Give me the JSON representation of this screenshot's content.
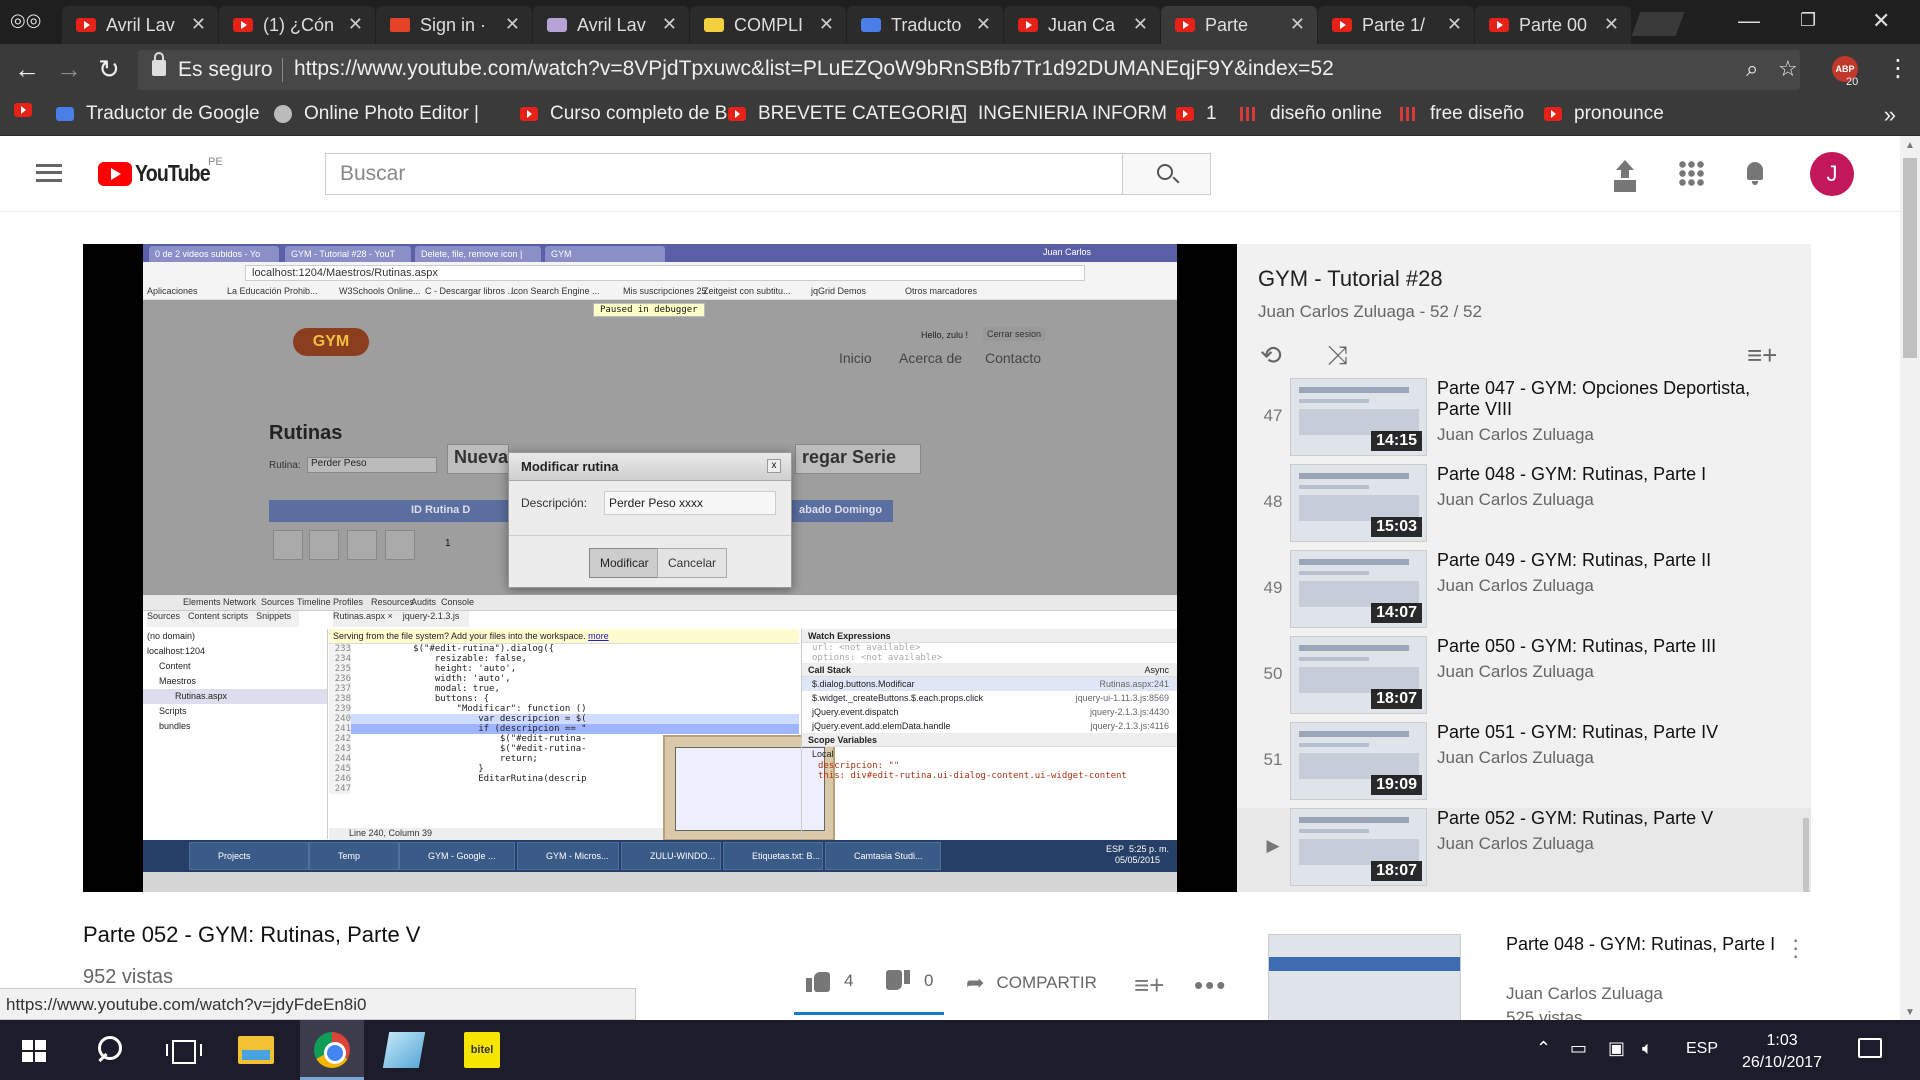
{
  "browser": {
    "tabs": [
      {
        "label": "Avril Lav",
        "icon": "youtube-icon"
      },
      {
        "label": "(1) ¿Cón",
        "icon": "youtube-icon"
      },
      {
        "label": "Sign in ·",
        "icon": "gitlab-icon"
      },
      {
        "label": "Avril Lav",
        "icon": "pattern-icon"
      },
      {
        "label": "COMPLI",
        "icon": "star-icon"
      },
      {
        "label": "Traducto",
        "icon": "google-translate-icon"
      },
      {
        "label": "Juan Ca",
        "icon": "youtube-icon"
      },
      {
        "label": "Parte",
        "icon": "youtube-icon"
      },
      {
        "label": "Parte 1/",
        "icon": "youtube-icon"
      },
      {
        "label": "Parte 00",
        "icon": "youtube-icon"
      }
    ],
    "active_tab_index": 7,
    "secure_label": "Es seguro",
    "url": "https://www.youtube.com/watch?v=8VPjdTpxuwc&list=PLuEZQoW9bRnSBfb7Tr1d92DUMANEqjF9Y&index=52",
    "extension_label": "ABP",
    "extension_badge": "20",
    "bookmarks": [
      {
        "label": "",
        "icon": "youtube-icon"
      },
      {
        "label": "Traductor de Google",
        "icon": "google-translate-icon"
      },
      {
        "label": "Online Photo Editor |",
        "icon": "photo-editor-icon"
      },
      {
        "label": "Curso completo de B",
        "icon": "youtube-icon"
      },
      {
        "label": "BREVETE CATEGORIA",
        "icon": "youtube-icon"
      },
      {
        "label": "INGENIERIA INFORM",
        "icon": "document-icon"
      },
      {
        "label": "1",
        "icon": "youtube-icon"
      },
      {
        "label": "diseño online",
        "icon": "bars-icon"
      },
      {
        "label": "free diseño",
        "icon": "bars-icon"
      },
      {
        "label": "pronounce",
        "icon": "youtube-icon"
      }
    ],
    "more_bookmarks": "»"
  },
  "youtube": {
    "logo_text": "YouTube",
    "country": "PE",
    "search_placeholder": "Buscar",
    "avatar_initial": "J"
  },
  "video_frame": {
    "tabs": [
      "0 de 2 videos subidos - Yo",
      "GYM - Tutorial #28 - YouT",
      "Delete, file, remove icon |",
      "GYM"
    ],
    "user": "Juan Carlos",
    "url": "localhost:1204/Maestros/Rutinas.aspx",
    "bookmarks": [
      "Aplicaciones",
      "La Educación Prohib...",
      "W3Schools Online...",
      "C - Descargar libros ...",
      "Icon Search Engine ...",
      "Mis suscripciones 25",
      "Zeitgeist con subtitu...",
      "jqGrid Demos",
      "Otros marcadores"
    ],
    "debugger_label": "Paused in debugger",
    "site_logo": "GYM",
    "hello": "Hello, zulu !",
    "logout": "Cerrar sesion",
    "nav": [
      "Inicio",
      "Acerca de",
      "Contacto"
    ],
    "page_title": "Rutinas",
    "rutina_label": "Rutina:",
    "rutina_value": "Perder Peso",
    "btn_nueva": "Nueva R",
    "btn_agregar": "regar Serie",
    "thead_left": "ID Rutina D",
    "thead_right": "abado Domingo",
    "row_id": "1",
    "dialog": {
      "title": "Modificar rutina",
      "close": "x",
      "label": "Descripción:",
      "value": "Perder Peso xxxx",
      "ok": "Modificar",
      "cancel": "Cancelar"
    },
    "devtools_tabs": [
      "Elements",
      "Network",
      "Sources",
      "Timeline",
      "Profiles",
      "Resources",
      "Audits",
      "Console"
    ],
    "subtabs": [
      "Sources",
      "Content scripts",
      "Snippets"
    ],
    "file_tabs": [
      "Rutinas.aspx ×",
      "jquery-2.1.3.js"
    ],
    "tree": [
      "(no domain)",
      "localhost:1204",
      "Content",
      "Maestros",
      "Rutinas.aspx",
      "Scripts",
      "bundles"
    ],
    "workspace_msg": "Serving from the file system? Add your files into the workspace.",
    "workspace_link": "more",
    "code_lines": [
      {
        "n": "233",
        "t": "          $(\"#edit-rutina\").dialog({"
      },
      {
        "n": "234",
        "t": "              resizable: false,"
      },
      {
        "n": "235",
        "t": "              height: 'auto',"
      },
      {
        "n": "236",
        "t": "              width: 'auto',"
      },
      {
        "n": "237",
        "t": "              modal: true,"
      },
      {
        "n": "238",
        "t": "              buttons: {"
      },
      {
        "n": "239",
        "t": "                  \"Modificar\": function ()"
      },
      {
        "n": "240",
        "t": "                      var descripcion = $("
      },
      {
        "n": "241",
        "t": "                      if (descripcion == \""
      },
      {
        "n": "242",
        "t": "                          $(\"#edit-rutina-"
      },
      {
        "n": "243",
        "t": "                          $(\"#edit-rutina-"
      },
      {
        "n": "244",
        "t": "                          return;"
      },
      {
        "n": "245",
        "t": "                      }"
      },
      {
        "n": "246",
        "t": "                      EditarRutina(descrip"
      },
      {
        "n": "247",
        "t": ""
      }
    ],
    "status": "Line 240, Column 39",
    "watch_label": "Watch Expressions",
    "watch_items": [
      "url: <not available>",
      "options: <not available>"
    ],
    "callstack_label": "Call Stack",
    "async_label": "Async",
    "callstack": [
      {
        "fn": "$.dialog.buttons.Modificar",
        "file": "Rutinas.aspx:241"
      },
      {
        "fn": "$.widget._createButtons.$.each.props.click",
        "file": "jquery-ui-1.11.3.js:8569"
      },
      {
        "fn": "jQuery.event.dispatch",
        "file": "jquery-2.1.3.js:4430"
      },
      {
        "fn": "jQuery.event.add.elemData.handle",
        "file": "jquery-2.1.3.js:4116"
      }
    ],
    "scope_label": "Scope Variables",
    "local_label": "Local",
    "local_items": [
      "descripcion: \"\"",
      "this: div#edit-rutina.ui-dialog-content.ui-widget-content"
    ],
    "taskbar": [
      "Projects",
      "Temp",
      "GYM - Google ...",
      "GYM - Micros...",
      "ZULU-WINDO...",
      "Etiquetas.txt: B...",
      "Camtasia Studi..."
    ],
    "lang": "ESP",
    "time": "5:25 p. m.",
    "date": "05/05/2015"
  },
  "playlist": {
    "title": "GYM - Tutorial #28",
    "subtitle": "Juan Carlos Zuluaga - 52 / 52",
    "items": [
      {
        "index": "47",
        "title": "Parte 047 - GYM: Opciones Deportista, Parte VIII",
        "channel": "Juan Carlos Zuluaga",
        "duration": "14:15"
      },
      {
        "index": "48",
        "title": "Parte 048 - GYM: Rutinas, Parte I",
        "channel": "Juan Carlos Zuluaga",
        "duration": "15:03"
      },
      {
        "index": "49",
        "title": "Parte 049 - GYM: Rutinas, Parte II",
        "channel": "Juan Carlos Zuluaga",
        "duration": "14:07"
      },
      {
        "index": "50",
        "title": "Parte 050 - GYM: Rutinas, Parte III",
        "channel": "Juan Carlos Zuluaga",
        "duration": "18:07"
      },
      {
        "index": "51",
        "title": "Parte 051 - GYM: Rutinas, Parte IV",
        "channel": "Juan Carlos Zuluaga",
        "duration": "19:09"
      },
      {
        "index": "▶",
        "title": "Parte 052 - GYM: Rutinas, Parte V",
        "channel": "Juan Carlos Zuluaga",
        "duration": "18:07"
      }
    ]
  },
  "video": {
    "title": "Parte 052 - GYM: Rutinas, Parte V",
    "views": "952 vistas",
    "likes": "4",
    "dislikes": "0",
    "share": "COMPARTIR"
  },
  "up_next": {
    "title": "Parte 048 - GYM: Rutinas, Parte I",
    "channel": "Juan Carlos Zuluaga",
    "views": "525 vistas"
  },
  "status_url": "https://www.youtube.com/watch?v=jdyFdeEn8i0",
  "taskbar": {
    "lang": "ESP",
    "time": "1:03",
    "date": "26/10/2017"
  },
  "colors": {
    "youtube_red": "#ff0000",
    "avatar": "#c2185b",
    "like_bar": "#167ac6"
  }
}
